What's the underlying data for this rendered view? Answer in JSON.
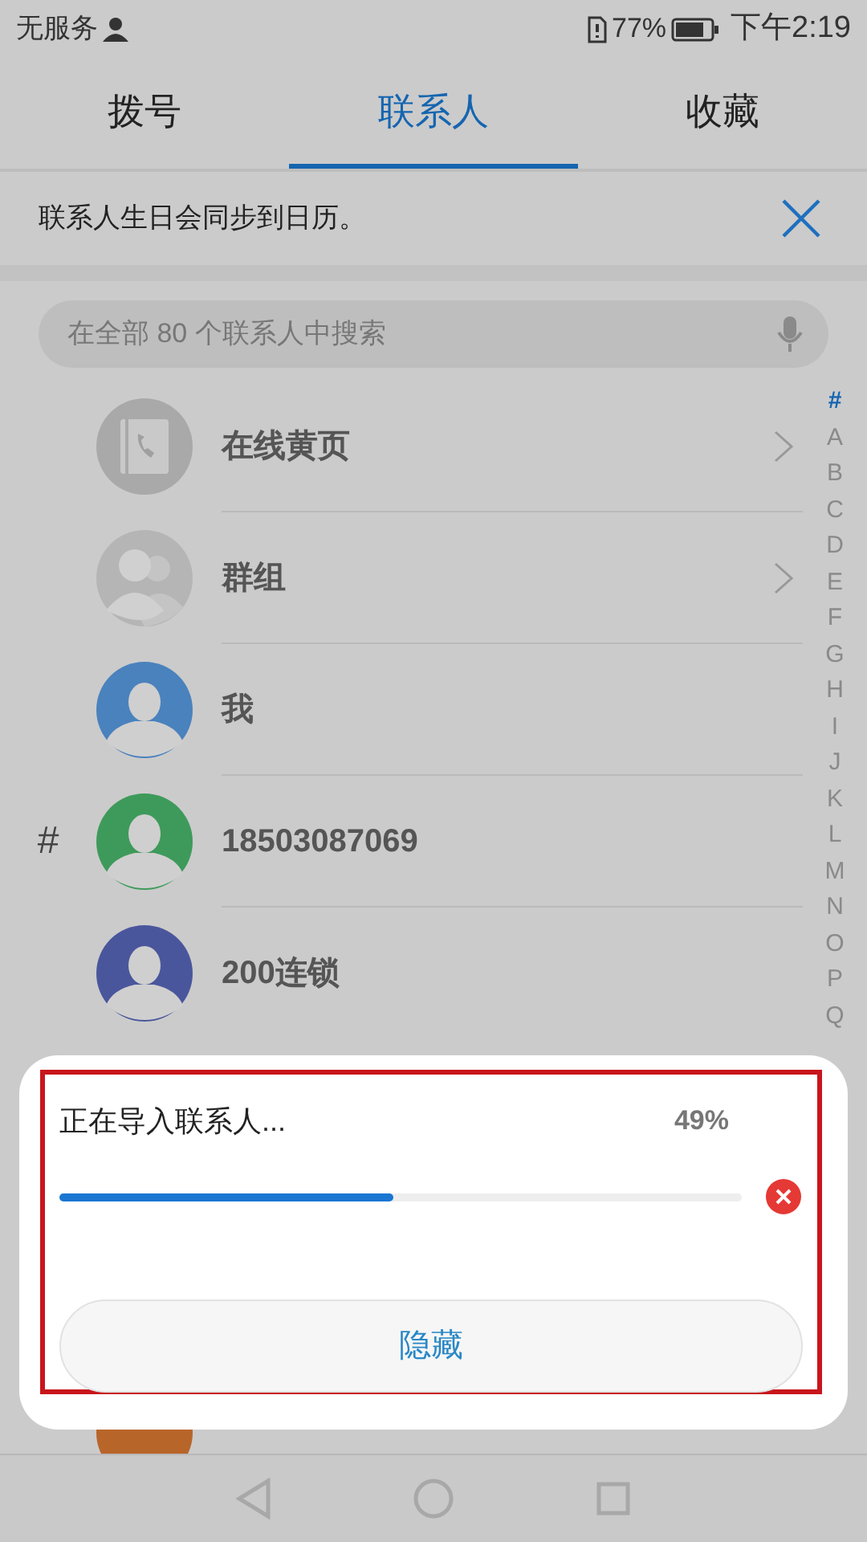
{
  "status_bar": {
    "carrier": "无服务",
    "battery": "77%",
    "time": "下午2:19"
  },
  "tabs": [
    {
      "label": "拨号",
      "selected": false
    },
    {
      "label": "联系人",
      "selected": true
    },
    {
      "label": "收藏",
      "selected": false
    }
  ],
  "banner": {
    "text": "联系人生日会同步到日历。"
  },
  "search": {
    "placeholder": "在全部 80 个联系人中搜索"
  },
  "contacts": [
    {
      "kind": "yellow_pages",
      "name": "在线黄页",
      "color": "#a9a9a9"
    },
    {
      "kind": "groups",
      "name": "群组",
      "color": "#b5b5b5"
    },
    {
      "kind": "person",
      "name": "我",
      "color": "#4a82bd"
    },
    {
      "kind": "person",
      "name": "18503087069",
      "color": "#3e9a5a",
      "section": "#"
    },
    {
      "kind": "person",
      "name": "200连锁",
      "color": "#4a569c"
    }
  ],
  "index_bar": [
    {
      "label": "#",
      "selected": true
    },
    {
      "label": "A",
      "selected": false
    },
    {
      "label": "B",
      "selected": false
    },
    {
      "label": "C",
      "selected": false
    },
    {
      "label": "D",
      "selected": false
    },
    {
      "label": "E",
      "selected": false
    },
    {
      "label": "F",
      "selected": false
    },
    {
      "label": "G",
      "selected": false
    },
    {
      "label": "H",
      "selected": false
    },
    {
      "label": "I",
      "selected": false
    },
    {
      "label": "J",
      "selected": false
    },
    {
      "label": "K",
      "selected": false
    },
    {
      "label": "L",
      "selected": false
    },
    {
      "label": "M",
      "selected": false
    },
    {
      "label": "N",
      "selected": false
    },
    {
      "label": "O",
      "selected": false
    },
    {
      "label": "P",
      "selected": false
    },
    {
      "label": "Q",
      "selected": false
    }
  ],
  "dialog": {
    "title": "正在导入联系人...",
    "percent": "49%",
    "level": 0.49,
    "button": "隐藏"
  }
}
